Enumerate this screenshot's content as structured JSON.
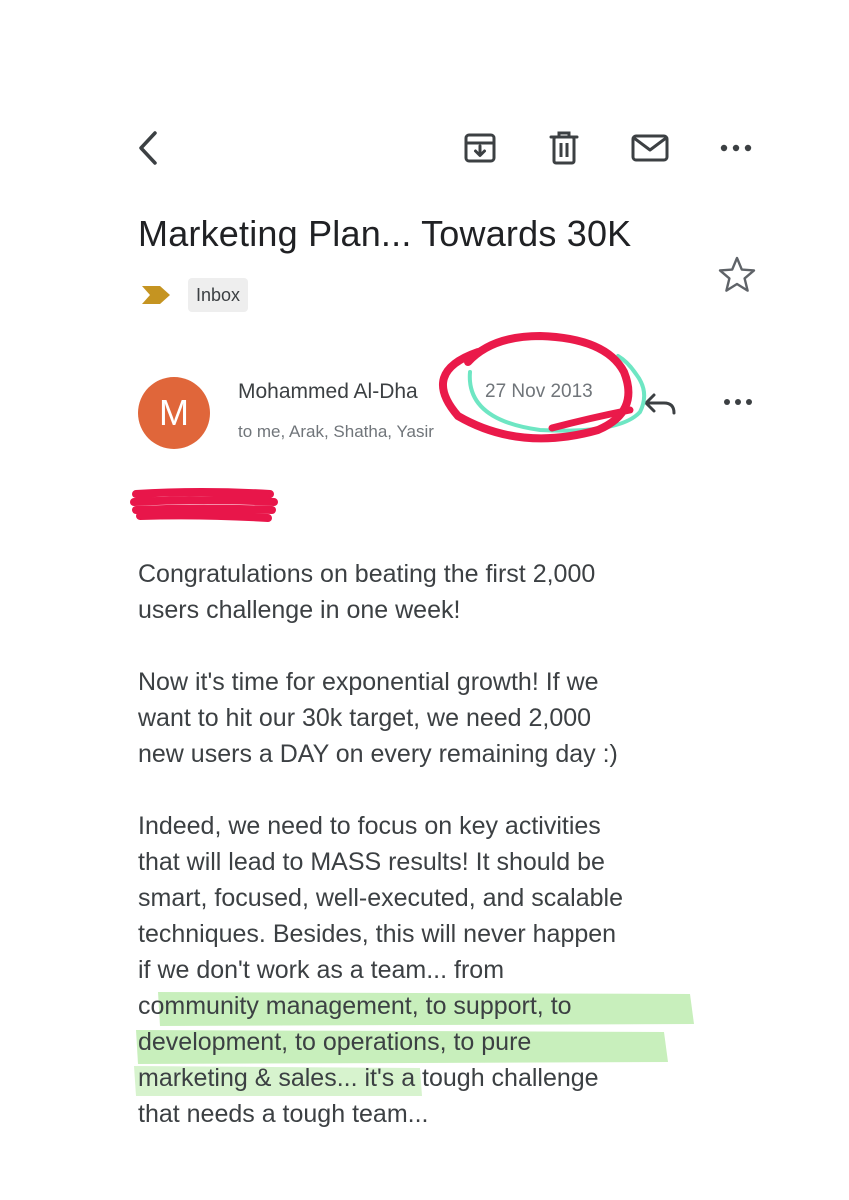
{
  "toolbar": {
    "back_icon": "arrow-back-icon",
    "archive_icon": "archive-icon",
    "delete_icon": "trash-icon",
    "unread_icon": "mail-icon",
    "more_icon": "more-horizontal-icon"
  },
  "email": {
    "subject": "Marketing Plan... Towards 30K",
    "label": "Inbox",
    "label_icon": "important-marker-icon",
    "label_icon_color": "#c59421",
    "star_icon": "star-outline-icon",
    "sender": {
      "initial": "M",
      "avatar_color": "#e0663a",
      "name": "Mohammed Al-Dha",
      "date": "27 Nov 2013",
      "recipients": "to me, Arak, Shatha, Yasir"
    },
    "reply_icon": "reply-icon",
    "more_icon": "more-horizontal-icon",
    "body": {
      "p1_lines": [
        "Congratulations on beating the first 2,000",
        "users challenge in one week!"
      ],
      "p2_lines": [
        "Now it's time for exponential growth! If we",
        "want to hit our 30k target, we need 2,000",
        "new users a DAY on every remaining day :)"
      ],
      "p3_lines": [
        "Indeed, we need to focus on key activities",
        "that will lead to MASS results! It should be",
        "smart, focused, well-executed, and scalable",
        "techniques. Besides, this will never happen",
        "if we don't work as a team... from",
        "community management, to support, to",
        "development, to operations, to pure",
        "marketing & sales... it's a tough challenge",
        "that needs a tough team..."
      ]
    }
  },
  "annotations": {
    "circle_color": "#ea1a4a",
    "cyan_color": "#6ee6c3",
    "highlight_color": "#9fe08a",
    "redaction_color": "#e8164a"
  }
}
